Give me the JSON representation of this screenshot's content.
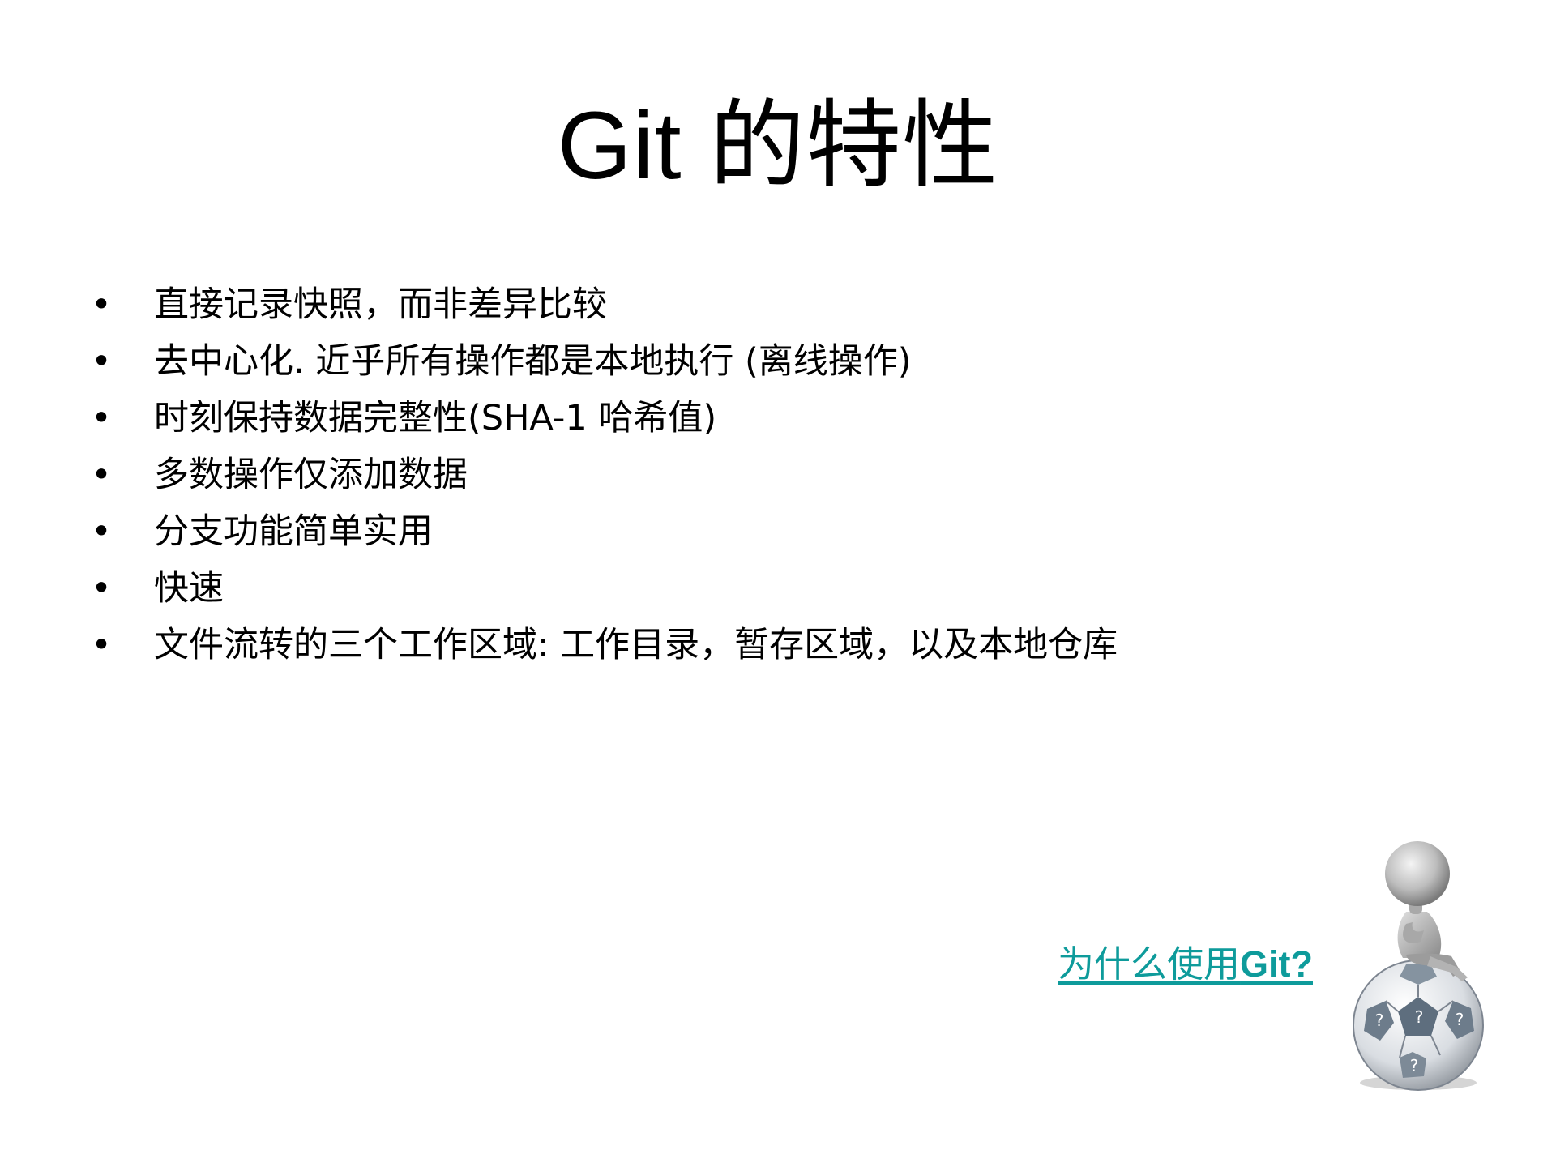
{
  "slide": {
    "title": "Git 的特性",
    "bullet_symbol": "•",
    "bullets": [
      "直接记录快照，而非差异比较",
      "去中心化. 近乎所有操作都是本地执行 (离线操作)",
      "时刻保持数据完整性(SHA-1 哈希值)",
      "多数操作仅添加数据",
      "分支功能简单实用",
      "快速",
      "文件流转的三个工作区域: 工作目录，暂存区域，以及本地仓库"
    ]
  },
  "link": {
    "text_prefix": "为什么使用",
    "text_bold": "Git?",
    "color": "#0e9b9b"
  },
  "image": {
    "icon": "thinker-on-question-ball-icon",
    "ball_glyph": "?"
  }
}
